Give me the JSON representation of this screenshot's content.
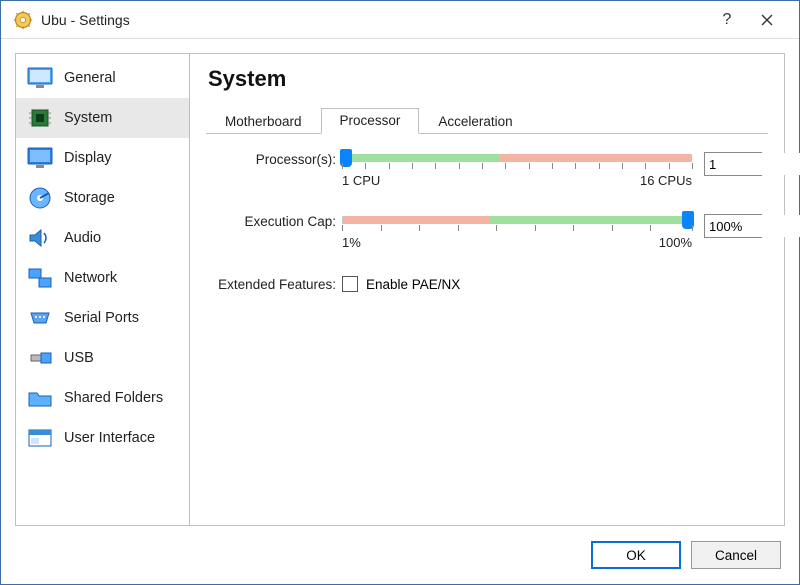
{
  "window": {
    "title": "Ubu - Settings"
  },
  "sidebar": {
    "items": [
      {
        "label": "General"
      },
      {
        "label": "System"
      },
      {
        "label": "Display"
      },
      {
        "label": "Storage"
      },
      {
        "label": "Audio"
      },
      {
        "label": "Network"
      },
      {
        "label": "Serial Ports"
      },
      {
        "label": "USB"
      },
      {
        "label": "Shared Folders"
      },
      {
        "label": "User Interface"
      }
    ],
    "selected_index": 1
  },
  "main": {
    "heading": "System",
    "tabs": [
      {
        "label": "Motherboard"
      },
      {
        "label": "Processor"
      },
      {
        "label": "Acceleration"
      }
    ],
    "active_tab_index": 1,
    "processor": {
      "processors_label": "Processor(s):",
      "processors_value": "1",
      "processors_scale_min_label": "1 CPU",
      "processors_scale_max_label": "16 CPUs",
      "exec_cap_label": "Execution Cap:",
      "exec_cap_value": "100%",
      "exec_cap_scale_min_label": "1%",
      "exec_cap_scale_max_label": "100%",
      "extended_label": "Extended Features:",
      "pae_label": "Enable PAE/NX"
    }
  },
  "footer": {
    "ok_label": "OK",
    "cancel_label": "Cancel"
  }
}
